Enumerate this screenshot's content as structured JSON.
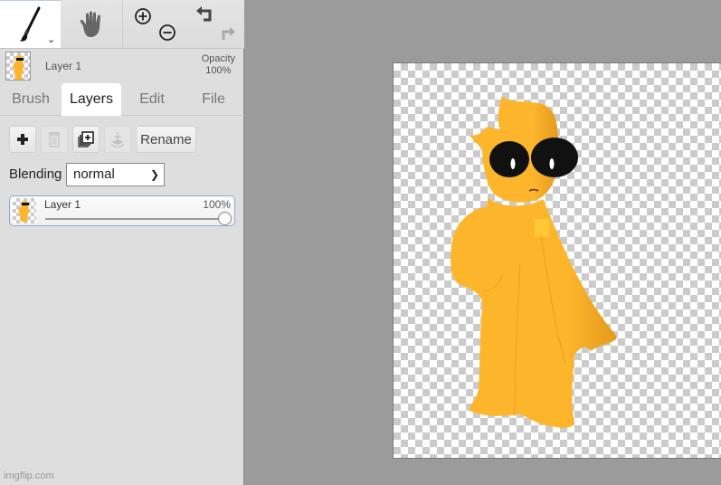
{
  "toolbar": {
    "tools": [
      {
        "name": "brush",
        "icon": "paintbrush-icon",
        "active": true,
        "has_dropdown": true
      },
      {
        "name": "hand",
        "icon": "hand-icon",
        "active": false
      },
      {
        "name": "zoom",
        "icons": [
          "zoom-in-icon",
          "zoom-out-icon"
        ]
      },
      {
        "name": "history",
        "icons": [
          "undo-icon",
          "redo-icon"
        ],
        "redo_enabled": false
      }
    ]
  },
  "layer_header": {
    "name": "Layer 1",
    "opacity_label": "Opacity",
    "opacity_value": "100%"
  },
  "tabs": [
    {
      "label": "Brush",
      "active": false
    },
    {
      "label": "Layers",
      "active": true
    },
    {
      "label": "Edit",
      "active": false
    },
    {
      "label": "File",
      "active": false
    }
  ],
  "layer_actions": {
    "add": {
      "icon": "plus-icon",
      "enabled": true
    },
    "delete": {
      "icon": "trash-icon",
      "enabled": false
    },
    "duplicate": {
      "icon": "duplicate-icon",
      "enabled": true
    },
    "merge_down": {
      "icon": "merge-down-icon",
      "enabled": false
    },
    "rename_label": "Rename"
  },
  "blending": {
    "label": "Blending",
    "selected": "normal"
  },
  "layers": [
    {
      "name": "Layer 1",
      "opacity_text": "100%",
      "opacity": 1.0,
      "selected": true
    }
  ],
  "footer": {
    "watermark": "imgflip.com"
  },
  "colors": {
    "character_fill": "#fdb62c",
    "character_shade": "#e59a1c",
    "eyes": "#111111",
    "selected_border": "#8fa8d0"
  }
}
